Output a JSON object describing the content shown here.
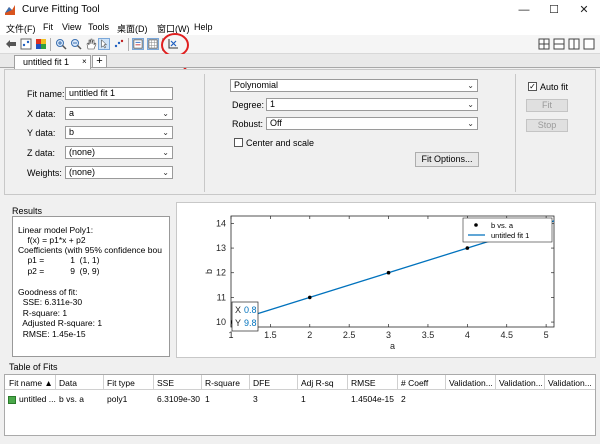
{
  "window": {
    "title": "Curve Fitting Tool",
    "controls": [
      "—",
      "☐",
      "✕"
    ]
  },
  "menu": [
    "文件(F)",
    "Fit",
    "View",
    "Tools",
    "桌面(D)",
    "窗口(W)",
    "Help"
  ],
  "tabs": {
    "active_label": "untitled fit 1",
    "close": "×",
    "add": "+"
  },
  "fit_setup": {
    "fit_name_label": "Fit name:",
    "fit_name_value": "untitled fit 1",
    "x_label": "X data:",
    "x_value": "a",
    "y_label": "Y data:",
    "y_value": "b",
    "z_label": "Z data:",
    "z_value": "(none)",
    "w_label": "Weights:",
    "w_value": "(none)"
  },
  "fit_type": {
    "type_value": "Polynomial",
    "degree_label": "Degree:",
    "degree_value": "1",
    "robust_label": "Robust:",
    "robust_value": "Off",
    "center_scale_label": "Center and scale",
    "center_scale_checked": false,
    "fit_options_label": "Fit Options..."
  },
  "fit_controls": {
    "auto_fit_label": "Auto fit",
    "auto_fit_checked": true,
    "fit_label": "Fit",
    "stop_label": "Stop"
  },
  "results": {
    "header": "Results",
    "lines": [
      "Linear model Poly1:",
      "    f(x) = p1*x + p2",
      "Coefficients (with 95% confidence bou",
      "    p1 =           1  (1, 1)",
      "    p2 =           9  (9, 9)",
      "",
      "Goodness of fit:",
      "  SSE: 6.311e-30",
      "  R-square: 1",
      "  Adjusted R-square: 1",
      "  RMSE: 1.45e-15"
    ]
  },
  "chart_data": {
    "type": "line",
    "xlabel": "a",
    "ylabel": "b",
    "xlim": [
      1,
      5.1
    ],
    "ylim": [
      9.8,
      14.3
    ],
    "xticks": [
      "1",
      "1.5",
      "2",
      "2.5",
      "3",
      "3.5",
      "4",
      "4.5",
      "5"
    ],
    "yticks": [
      "10",
      "11",
      "12",
      "13",
      "14"
    ],
    "series": [
      {
        "name": "b vs. a",
        "style": "points",
        "x": [
          1,
          2,
          3,
          4,
          5
        ],
        "y": [
          10,
          11,
          12,
          13,
          14
        ]
      },
      {
        "name": "untitled fit 1",
        "style": "line",
        "x": [
          0.8,
          5.4
        ],
        "y": [
          9.8,
          14.4
        ]
      }
    ],
    "legend_position": "top-right",
    "datatip": {
      "x_label": "X",
      "x": "0.8",
      "y_label": "Y",
      "y": "9.8"
    },
    "colors": {
      "fit_line": "#0072bd",
      "points": "#000000"
    }
  },
  "table_of_fits": {
    "title": "Table of Fits",
    "columns": [
      "Fit name ▲",
      "Data",
      "Fit type",
      "SSE",
      "R-square",
      "DFE",
      "Adj R-sq",
      "RMSE",
      "# Coeff",
      "Validation...",
      "Validation...",
      "Validation..."
    ],
    "rows": [
      [
        "untitled ...",
        "b vs. a",
        "poly1",
        "6.3109e-30",
        "1",
        "3",
        "1",
        "1.4504e-15",
        "2",
        "",
        "",
        ""
      ]
    ]
  }
}
